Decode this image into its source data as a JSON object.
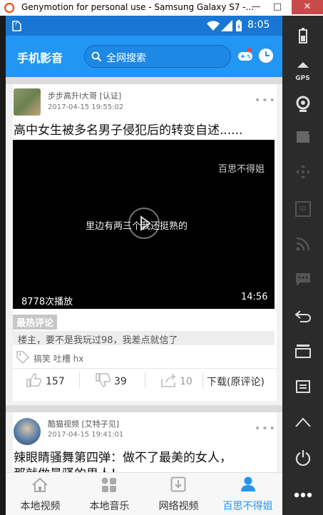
{
  "window": {
    "title": "Genymotion for personal use - Samsung Galaxy S7 -...",
    "minimize": "—",
    "maximize": "□",
    "close": "✕"
  },
  "statusbar": {
    "time": "8:05",
    "sim": "?"
  },
  "appbar": {
    "title": "手机影音",
    "search_label": "全网搜索"
  },
  "posts": [
    {
      "user": "步步高升l大哥 [认证]",
      "time": "2017-04-15 19:55:02",
      "title": "高中女生被多名男子侵犯后的转变自述......",
      "video": {
        "watermark": "百思不得姐",
        "subtitle": "里边有两三个我还挺熟的",
        "plays": "8778次播放",
        "duration": "14:56"
      },
      "hot_label": "最热评论",
      "hot_comment": "楼主，要不是我玩过98，我差点就信了",
      "tags": "搞笑 吐槽 hx",
      "likes": "157",
      "dislikes": "39",
      "shares": "10",
      "download": "下载(原评论)"
    },
    {
      "user": "酷猫视频 [艾特子见]",
      "time": "2017-04-15 19:41:01",
      "title_line1": "辣眼睛骚舞第四弹：做不了最美的女人，",
      "title_line2": "那就做最骚的男人！"
    }
  ],
  "bottom_nav": [
    {
      "label": "本地视频",
      "icon": "home-icon"
    },
    {
      "label": "本地音乐",
      "icon": "grid-icon"
    },
    {
      "label": "网络视频",
      "icon": "download-icon"
    },
    {
      "label": "百思不得姐",
      "icon": "person-icon"
    }
  ],
  "toolbar": {
    "gps": "GPS",
    "id": "ID"
  },
  "colors": {
    "primary": "#2196f3",
    "statusbar": "#1976d2",
    "toolbar": "#2b2b2b"
  }
}
